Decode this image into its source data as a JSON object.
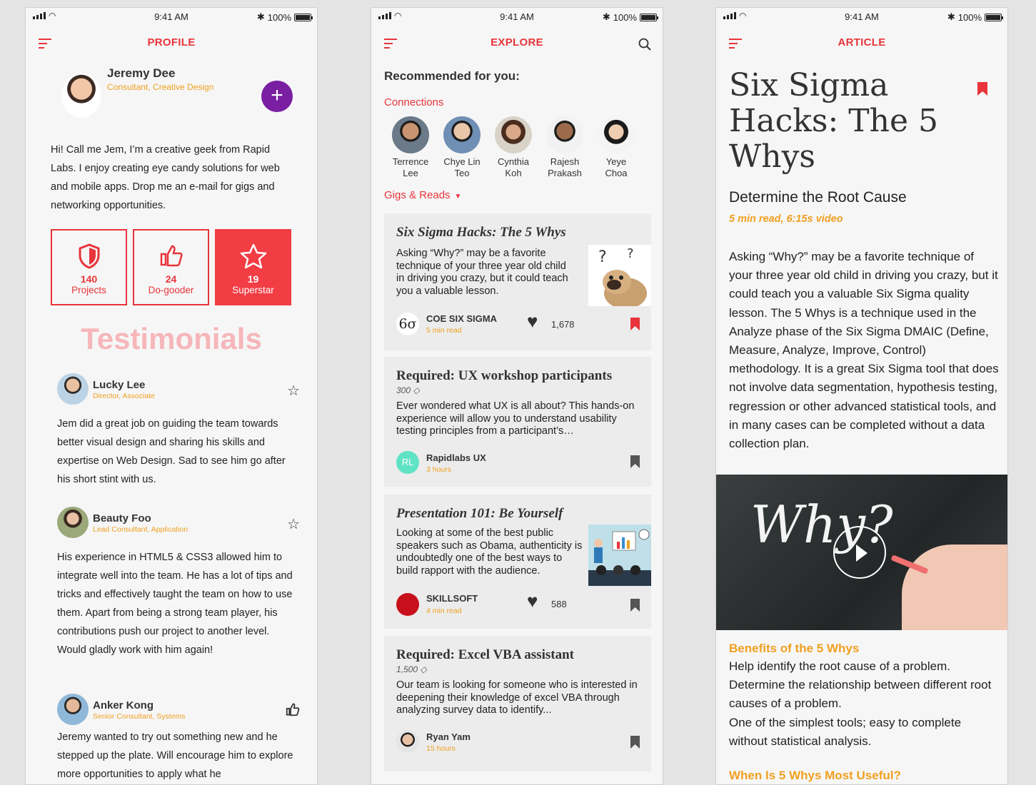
{
  "status": {
    "time": "9:41 AM",
    "battery": "100%"
  },
  "profile": {
    "header_title": "PROFILE",
    "name": "Jeremy Dee",
    "role": "Consultant, Creative Design",
    "bio": "Hi! Call me Jem, I’m a creative geek from Rapid Labs. I enjoy creating eye candy solutions for web and mobile apps. Drop me an e-mail for gigs and networking opportunities.",
    "stats": [
      {
        "value": "140",
        "label": "Projects",
        "icon": "shield-icon"
      },
      {
        "value": "24",
        "label": "Do-gooder",
        "icon": "thumbs-up-icon"
      },
      {
        "value": "19",
        "label": "Superstar",
        "icon": "star-icon"
      }
    ],
    "testimonials_title": "Testimonials",
    "testimonials": [
      {
        "name": "Lucky Lee",
        "role": "Director, Associate",
        "text": "Jem did a great job on guiding the team towards better visual design and sharing his skills and expertise on Web Design. Sad to see him go after his short stint with us.",
        "icon": "star-outline-icon"
      },
      {
        "name": "Beauty Foo",
        "role": "Lead Consultant, Application",
        "text": "His experience in HTML5 & CSS3 allowed him to integrate well into the team. He has a lot of tips and tricks and effectively taught the team on how to use them. Apart from being a strong team player, his contributions push our project to another level. Would gladly work with him again!",
        "icon": "star-outline-icon"
      },
      {
        "name": "Anker Kong",
        "role": "Senior Consultant, Systems",
        "text": "Jeremy wanted to try out something new and he stepped up the plate. Will encourage him to explore more opportunities to apply what he",
        "icon": "thumbs-up-outline-icon"
      }
    ]
  },
  "explore": {
    "header_title": "EXPLORE",
    "recommended": "Recommended for you:",
    "connections_label": "Connections",
    "connections": [
      {
        "first": "Terrence",
        "last": "Lee"
      },
      {
        "first": "Chye Lin",
        "last": "Teo"
      },
      {
        "first": "Cynthia",
        "last": "Koh"
      },
      {
        "first": "Rajesh",
        "last": "Prakash"
      },
      {
        "first": "Yeye",
        "last": "Choa"
      }
    ],
    "gigs_label": "Gigs & Reads",
    "cards": [
      {
        "title": "Six Sigma Hacks: The 5 Whys",
        "desc": "Asking “Why?” may be a favorite technique of your three year old child in driving you crazy, but it could teach you a valuable lesson.",
        "source": "COE SIX SIGMA",
        "source_sub": "5 min read",
        "likes": "1,678",
        "source_mark": "6σ"
      },
      {
        "title": "Required: UX workshop participants",
        "points": "300",
        "desc": "Ever wondered what UX is all about? This hands-on experience will allow you to understand usability testing principles from a participant’s…",
        "source": "Rapidlabs UX",
        "source_sub": "3 hours",
        "source_mark": "RL"
      },
      {
        "title": "Presentation 101: Be Yourself",
        "desc": "Looking at some of the best public speakers such as Obama, authenticity is undoubtedly one of the best ways to build rapport with the audience.",
        "source": "SKILLSOFT",
        "source_sub": "4 min read",
        "likes": "588"
      },
      {
        "title": "Required: Excel VBA assistant",
        "points": "1,500",
        "desc": "Our team is looking for someone who is interested in deepening their knowledge of excel VBA through analyzing survey data to identify...",
        "source": "Ryan Yam",
        "source_sub": "15 hours"
      }
    ]
  },
  "article": {
    "header_title": "ARTICLE",
    "title": "Six Sigma Hacks: The 5 Whys",
    "subtitle": "Determine the Root Cause",
    "meta": "5 min read, 6:15s video",
    "body": "Asking “Why?” may be a favorite technique of your three year old child in driving you crazy, but it could teach you a valuable Six Sigma quality lesson. The 5 Whys is a technique used in the Analyze phase of the Six Sigma DMAIC (Define, Measure, Analyze, Improve, Control) methodology. It is a great Six Sigma tool that does not involve data segmentation, hypothesis testing, regression or other advanced statistical tools, and in many cases can be completed without a data collection plan.",
    "video_text": "Why?",
    "benefits_title": "Benefits of the 5 Whys",
    "benefits": [
      "Help identify the root cause of a problem.",
      "Determine the relationship between different root causes of a problem.",
      "One of the simplest tools; easy to complete without statistical analysis."
    ],
    "next_heading": "When Is 5 Whys Most Useful?"
  },
  "colors": {
    "accent": "#e8343a",
    "orange": "#f0a020",
    "purple": "#7a1fa2"
  }
}
